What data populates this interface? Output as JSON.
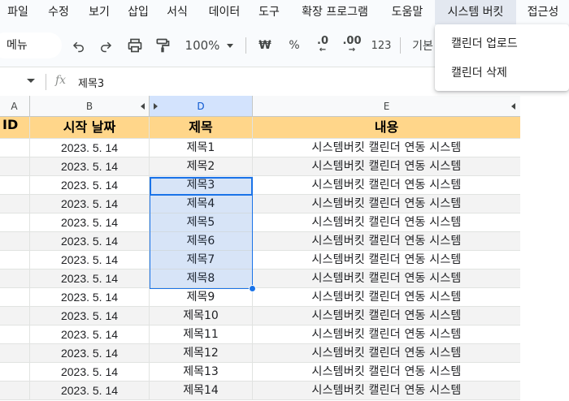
{
  "menubar": {
    "items": [
      "파일",
      "수정",
      "보기",
      "삽입",
      "서식",
      "데이터",
      "도구",
      "확장 프로그램",
      "도움말",
      "시스템 버킷",
      "접근성"
    ]
  },
  "toolbar": {
    "menu_search": "메뉴",
    "zoom": "100%",
    "currency": "₩",
    "percent": "%",
    "decrease_decimal": ".0",
    "increase_decimal": ".00",
    "number_format": "123",
    "format_default": "기본"
  },
  "formula_bar": {
    "fx": "fx",
    "content": "제목3"
  },
  "dropdown": {
    "items": [
      "캘린더 업로드",
      "캘린더 삭제"
    ]
  },
  "sheet": {
    "columns": [
      "A",
      "B",
      "D",
      "E"
    ],
    "header_row": {
      "id": "ID",
      "date": "시작 날짜",
      "title": "제목",
      "content": "내용"
    },
    "rows": [
      {
        "date": "2023. 5. 14",
        "title": "제목1",
        "content": "시스템버킷 캘린더 연동 시스템"
      },
      {
        "date": "2023. 5. 14",
        "title": "제목2",
        "content": "시스템버킷 캘린더 연동 시스템"
      },
      {
        "date": "2023. 5. 14",
        "title": "제목3",
        "content": "시스템버킷 캘린더 연동 시스템"
      },
      {
        "date": "2023. 5. 14",
        "title": "제목4",
        "content": "시스템버킷 캘린더 연동 시스템"
      },
      {
        "date": "2023. 5. 14",
        "title": "제목5",
        "content": "시스템버킷 캘린더 연동 시스템"
      },
      {
        "date": "2023. 5. 14",
        "title": "제목6",
        "content": "시스템버킷 캘린더 연동 시스템"
      },
      {
        "date": "2023. 5. 14",
        "title": "제목7",
        "content": "시스템버킷 캘린더 연동 시스템"
      },
      {
        "date": "2023. 5. 14",
        "title": "제목8",
        "content": "시스템버킷 캘린더 연동 시스템"
      },
      {
        "date": "2023. 5. 14",
        "title": "제목9",
        "content": "시스템버킷 캘린더 연동 시스템"
      },
      {
        "date": "2023. 5. 14",
        "title": "제목10",
        "content": "시스템버킷 캘린더 연동 시스템"
      },
      {
        "date": "2023. 5. 14",
        "title": "제목11",
        "content": "시스템버킷 캘린더 연동 시스템"
      },
      {
        "date": "2023. 5. 14",
        "title": "제목12",
        "content": "시스템버킷 캘린더 연동 시스템"
      },
      {
        "date": "2023. 5. 14",
        "title": "제목13",
        "content": "시스템버킷 캘린더 연동 시스템"
      },
      {
        "date": "2023. 5. 14",
        "title": "제목14",
        "content": "시스템버킷 캘린더 연동 시스템"
      }
    ]
  },
  "colors": {
    "header_fill": "#ffd68a",
    "selection": "#1a73e8",
    "selected_column_header": "#d3e3fd",
    "active_menu": "#e3e8f0"
  }
}
